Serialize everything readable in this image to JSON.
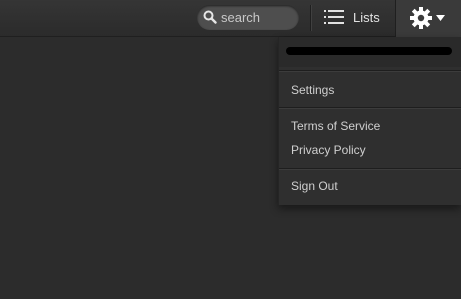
{
  "header": {
    "search": {
      "placeholder": "search",
      "icon": "search-icon"
    },
    "lists": {
      "label": "Lists",
      "icon": "list-icon"
    },
    "settings_menu": {
      "icon": "gear-icon",
      "caret_icon": "caret-down-icon"
    }
  },
  "menu": {
    "account_email": "",
    "items": {
      "settings": "Settings",
      "terms": "Terms of Service",
      "privacy": "Privacy Policy",
      "sign_out": "Sign Out"
    }
  },
  "colors": {
    "background": "#2c2c2c",
    "topbar": "#303030",
    "menu": "#2f2f2f",
    "text": "#cfcfcf"
  }
}
